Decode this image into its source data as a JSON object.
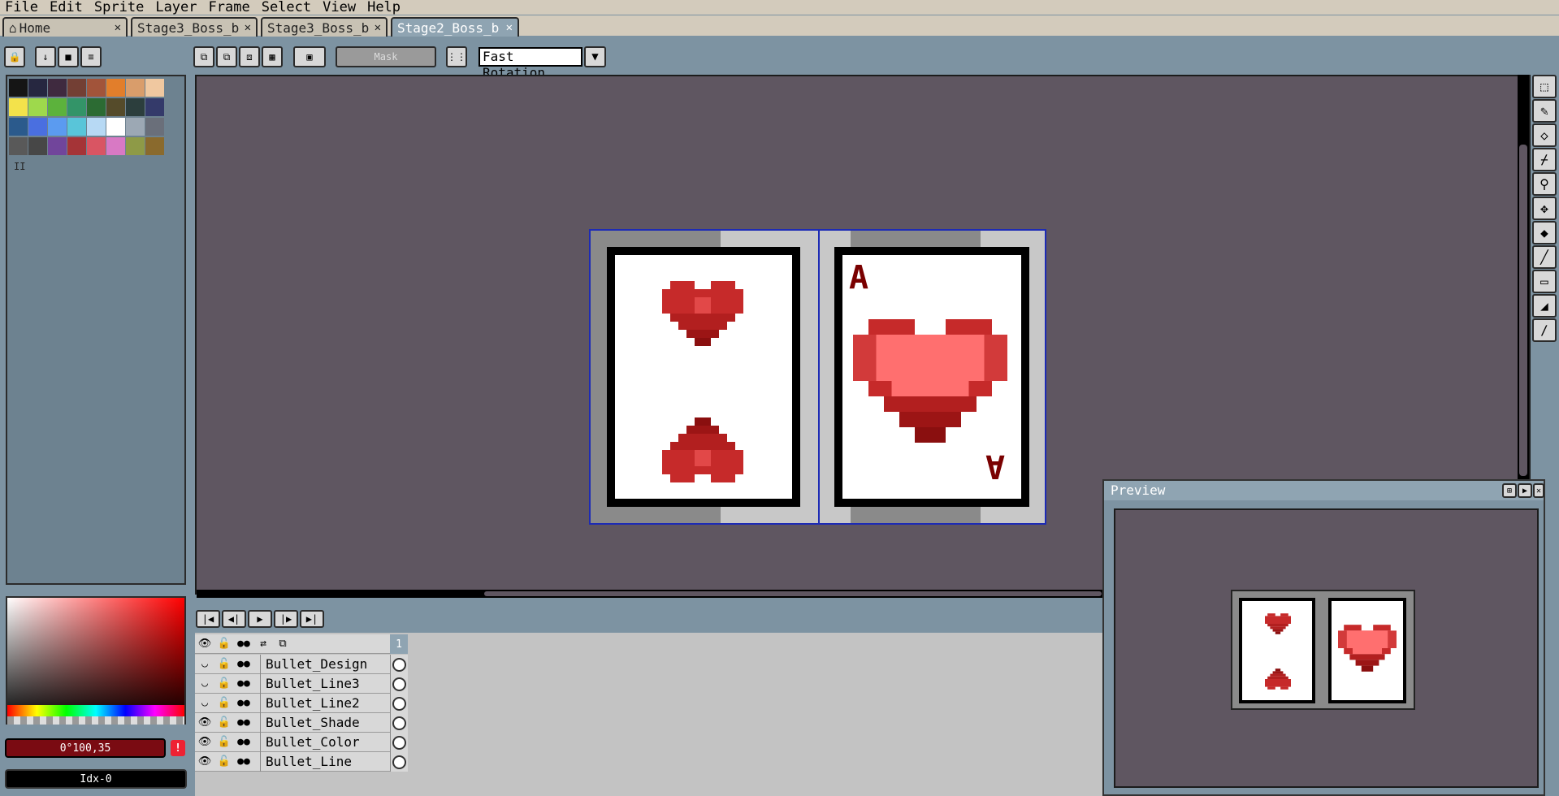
{
  "menu": [
    "File",
    "Edit",
    "Sprite",
    "Layer",
    "Frame",
    "Select",
    "View",
    "Help"
  ],
  "tabs": [
    {
      "label": "Home",
      "close": "✕"
    },
    {
      "label": "Stage3_Boss_b",
      "close": "✕"
    },
    {
      "label": "Stage3_Boss_b",
      "close": "✕"
    },
    {
      "label": "Stage2_Boss_b",
      "close": "✕"
    }
  ],
  "toolbar": {
    "mask_label": "Mask",
    "rotation_value": "Fast Rotation",
    "dropdown_arrow": "▼"
  },
  "palette": {
    "colors": [
      "#151515",
      "#262740",
      "#3f2a3f",
      "#733f34",
      "#a2543a",
      "#e27e2b",
      "#d99d6b",
      "#f0c8a0",
      "#f3e24b",
      "#9ed94c",
      "#5cb23c",
      "#339468",
      "#2c6b33",
      "#554b2a",
      "#2c3e3d",
      "#343a6a",
      "#2b5a8c",
      "#4a6fe0",
      "#5b9bf0",
      "#59c5d9",
      "#b7d9f4",
      "#ffffff",
      "#9ca8b4",
      "#6a6f7a",
      "#595959",
      "#474747",
      "#71459b",
      "#a53437",
      "#d95563",
      "#d879c4",
      "#8e9a47",
      "#8a6a2d"
    ],
    "marker": "II"
  },
  "color_field": "0°100,35",
  "warning": "!",
  "index_field": "Idx-0",
  "timeline": {
    "frame_number": "1",
    "layers": [
      "Bullet_Design",
      "Bullet_Line3",
      "Bullet_Line2",
      "Bullet_Shade",
      "Bullet_Color",
      "Bullet_Line"
    ]
  },
  "preview": {
    "title": "Preview"
  },
  "sprite": {
    "rank_letter": "A",
    "rank_letter_flipped": "A"
  }
}
